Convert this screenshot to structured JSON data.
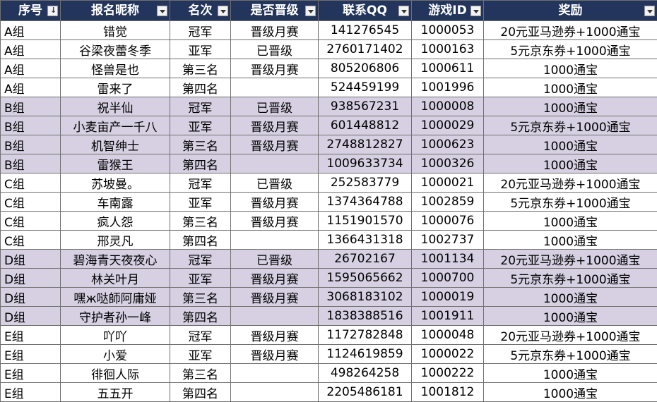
{
  "columns": [
    "序号",
    "报名昵称",
    "名次",
    "是否晋级",
    "联系QQ",
    "游戏ID",
    "奖励"
  ],
  "rows": [
    [
      "A组",
      "错觉",
      "冠军",
      "晋级月赛",
      "141276545",
      "1000053",
      "20元亚马逊券+1000通宝"
    ],
    [
      "A组",
      "谷梁夜蕾冬季",
      "亚军",
      "已晋级",
      "2760171402",
      "1000163",
      "5元京东券+1000通宝"
    ],
    [
      "A组",
      "怪兽是也",
      "第三名",
      "晋级月赛",
      "805206806",
      "1000611",
      "1000通宝"
    ],
    [
      "A组",
      "雷来了",
      "第四名",
      "",
      "524459199",
      "1001996",
      "1000通宝"
    ],
    [
      "B组",
      "祝半仙",
      "冠军",
      "已晋级",
      "938567231",
      "1000008",
      "1000通宝"
    ],
    [
      "B组",
      "小麦亩产一千八",
      "亚军",
      "晋级月赛",
      "601448812",
      "1000029",
      "5元京东券+1000通宝"
    ],
    [
      "B组",
      "机智绅士",
      "第三名",
      "晋级月赛",
      "2748812827",
      "1000623",
      "1000通宝"
    ],
    [
      "B组",
      "雷猴王",
      "第四名",
      "",
      "1009633734",
      "1000326",
      "1000通宝"
    ],
    [
      "C组",
      "苏坡曼。",
      "冠军",
      "已晋级",
      "252583779",
      "1000021",
      "20元亚马逊券+1000通宝"
    ],
    [
      "C组",
      "车南露",
      "亚军",
      "晋级月赛",
      "1374364788",
      "1002859",
      "5元京东券+1000通宝"
    ],
    [
      "C组",
      "疯人怨",
      "第三名",
      "晋级月赛",
      "1151901570",
      "1000076",
      "1000通宝"
    ],
    [
      "C组",
      "邢灵凡",
      "第四名",
      "",
      "1366431318",
      "1002737",
      "1000通宝"
    ],
    [
      "D组",
      "碧海青天夜夜心",
      "冠军",
      "已晋级",
      "26702167",
      "1001134",
      "20元亚马逊券+1000通宝"
    ],
    [
      "D组",
      "林关叶月",
      "亚军",
      "晋级月赛",
      "1595065662",
      "1000700",
      "5元京东券+1000通宝"
    ],
    [
      "D组",
      "嘿ж哒師阿庸娅",
      "第三名",
      "晋级月赛",
      "3068183102",
      "1000019",
      "1000通宝"
    ],
    [
      "D组",
      "守护者孙一峰",
      "第四名",
      "",
      "1838388516",
      "1001911",
      "1000通宝"
    ],
    [
      "E组",
      "吖吖",
      "冠军",
      "晋级月赛",
      "1172782848",
      "1000048",
      "20元亚马逊券+1000通宝"
    ],
    [
      "E组",
      "小爱",
      "亚军",
      "晋级月赛",
      "1124619859",
      "1000022",
      "5元京东券+1000通宝"
    ],
    [
      "E组",
      "徘徊人际",
      "第三名",
      "",
      "498264258",
      "1000222",
      "1000通宝"
    ],
    [
      "E组",
      "五五开",
      "第四名",
      "",
      "2205486181",
      "1001812",
      "1000通宝"
    ]
  ],
  "colors": {
    "header_bg": "#23355c",
    "header_text": "#ffffff",
    "band_fill": "#d6d0e2",
    "grid": "#6f6f6f"
  },
  "icons": {
    "filter": "filter-dropdown-icon",
    "sorted_filter": "sort-ascending-filter-icon"
  }
}
